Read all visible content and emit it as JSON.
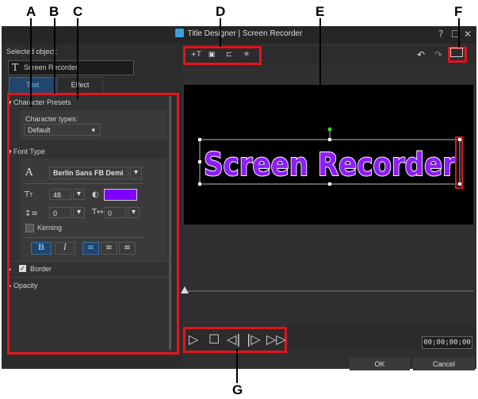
{
  "callouts": {
    "a": "A",
    "b": "B",
    "c": "C",
    "d": "D",
    "e": "E",
    "f": "F",
    "g": "G"
  },
  "window": {
    "title": "Title Designer  |  Screen Recorder",
    "help": "?",
    "maximize": "☐",
    "close": "✕"
  },
  "left_panel": {
    "selected_label": "Selected object:",
    "selected_icon": "T",
    "selected_value": "Screen Recorder",
    "tabs": {
      "text": "Text",
      "effect": "Effect"
    },
    "character_presets": {
      "header": "Character Presets",
      "types_label": "Character types:",
      "types_value": "Default"
    },
    "font_type": {
      "header": "Font Type",
      "font_icon": "A",
      "font_name": "Berlin Sans FB Demi",
      "size": "48",
      "font_color": "#8000ff",
      "line_spacing": "0",
      "char_spacing": "0",
      "kerning": "Kerning",
      "bold": "B",
      "italic": "I"
    },
    "border": {
      "header": "Border",
      "checked": true
    },
    "opacity": {
      "header": "Opacity"
    }
  },
  "toolbar": {
    "icons": [
      "insert-text-icon",
      "insert-image-icon",
      "insert-particle-icon",
      "insert-effect-icon"
    ]
  },
  "preview": {
    "text": "Screen Recorder",
    "text_color": "#8f1cff",
    "outline_color": "#ffffff"
  },
  "playback": {
    "timecode": "00;00;00;00"
  },
  "footer": {
    "ok": "OK",
    "cancel": "Cancel"
  },
  "colors": {
    "highlight": "#e3141f",
    "accent": "#3aa0e0"
  }
}
